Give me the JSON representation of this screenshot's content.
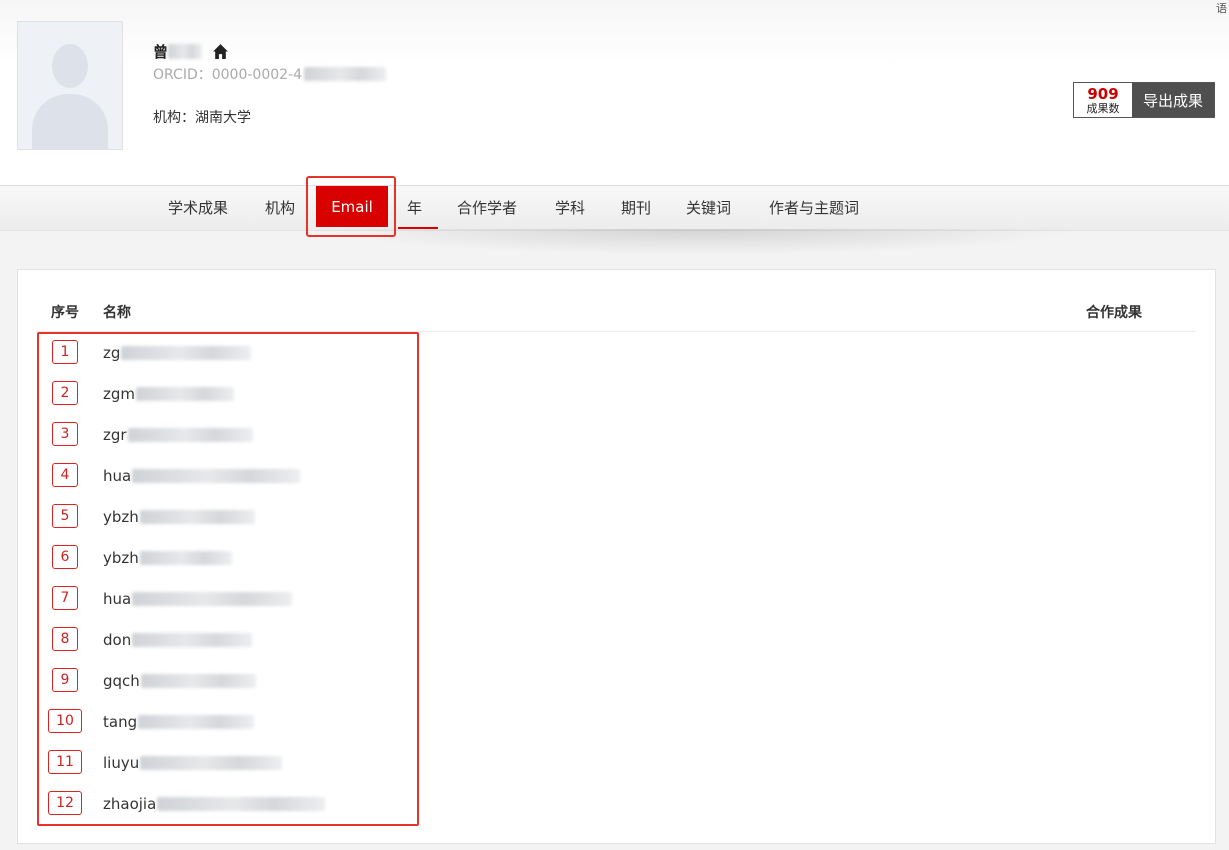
{
  "header": {
    "corner_glyph": "语",
    "name": "曾",
    "orcid": "ORCID：0000-0002-4",
    "org_label": "机构：湖南大学",
    "count": "909",
    "count_label": "成果数",
    "export_label": "导出成果"
  },
  "tabs": [
    "学术成果",
    "机构",
    "Email",
    "年",
    "合作学者",
    "学科",
    "期刊",
    "关键词",
    "作者与主题词"
  ],
  "active_tab": "Email",
  "table": {
    "col_index": "序号",
    "col_name": "名称",
    "col_collab": "合作成果",
    "rows": [
      {
        "index": "1",
        "email": "zg"
      },
      {
        "index": "2",
        "email": "zgm"
      },
      {
        "index": "3",
        "email": "zgr"
      },
      {
        "index": "4",
        "email": "hua"
      },
      {
        "index": "5",
        "email": "ybzh"
      },
      {
        "index": "6",
        "email": "ybzh"
      },
      {
        "index": "7",
        "email": "hua"
      },
      {
        "index": "8",
        "email": "don"
      },
      {
        "index": "9",
        "email": "gqch"
      },
      {
        "index": "10",
        "email": "tang"
      },
      {
        "index": "11",
        "email": "liuyu"
      },
      {
        "index": "12",
        "email": "zhaojia"
      }
    ]
  },
  "colors": {
    "accent": "#d90000",
    "highlight_outline": "#e8332a",
    "export_bg": "#4f4f4f"
  },
  "icons": {
    "home": "home-icon",
    "avatar": "avatar-placeholder"
  }
}
